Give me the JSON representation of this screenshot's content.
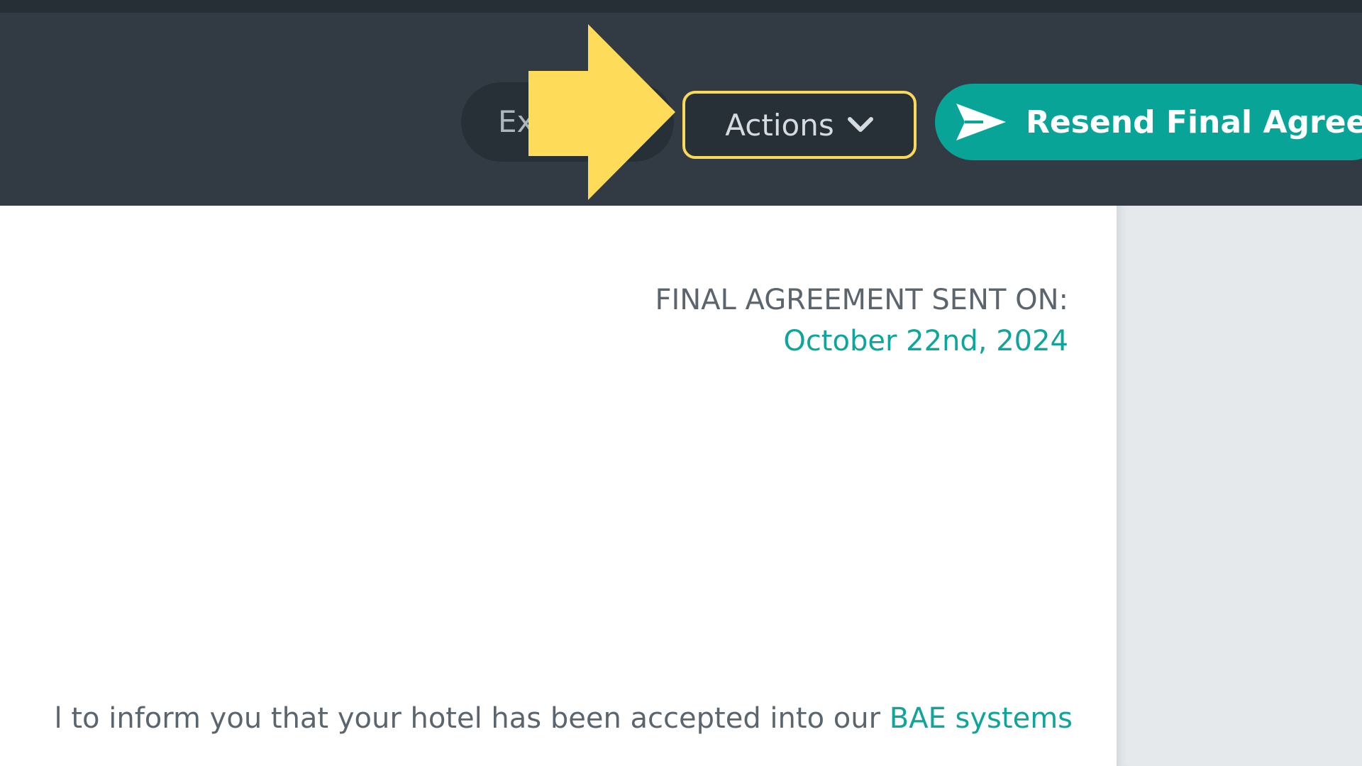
{
  "toolbar": {
    "export_label": "Ex",
    "actions_label": "Actions",
    "resend_label": "Resend Final Agreemen"
  },
  "document": {
    "sent_on_label": "FINAL AGREEMENT SENT ON:",
    "sent_on_date": "October 22nd, 2024",
    "paragraph_text": "l to inform you that your hotel has been accepted into our ",
    "paragraph_link": "BAE systems"
  },
  "icons": {
    "callout": "right-arrow-icon",
    "actions_dropdown": "chevron-down-icon",
    "resend": "send-icon"
  },
  "colors": {
    "toolbar_bg": "#323b43",
    "accent": "#08a497",
    "highlight": "#fad85a"
  }
}
